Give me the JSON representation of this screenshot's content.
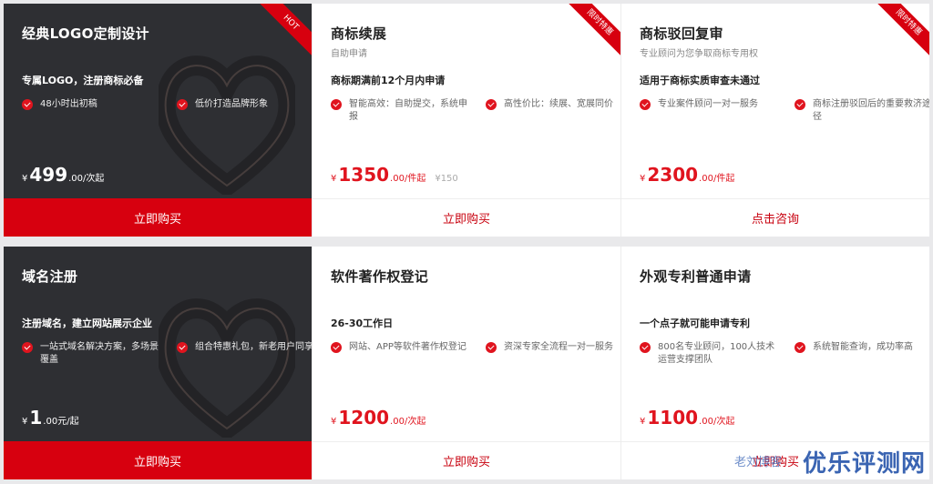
{
  "row1": {
    "card1": {
      "title": "经典LOGO定制设计",
      "headline": "专属LOGO，注册商标必备",
      "badge": "HOT",
      "features": [
        "48小时出初稿",
        "低价打造品牌形象"
      ],
      "currency": "¥",
      "amount": "499",
      "unit": ".00/次起",
      "button": "立即购买"
    },
    "card2": {
      "title": "商标续展",
      "subtitle": "自助申请",
      "headline": "商标期满前12个月内申请",
      "badge": "限时特惠",
      "features": [
        "智能高效：自助提交，系统申报",
        "高性价比：续展、宽展同价"
      ],
      "currency": "¥",
      "amount": "1350",
      "unit": ".00/件起",
      "original": "¥150",
      "button": "立即购买"
    },
    "card3": {
      "title": "商标驳回复审",
      "subtitle": "专业顾问为您争取商标专用权",
      "headline": "适用于商标实质审查未通过",
      "badge": "限时特惠",
      "features": [
        "专业案件顾问一对一服务",
        "商标注册驳回后的重要救济途径"
      ],
      "currency": "¥",
      "amount": "2300",
      "unit": ".00/件起",
      "button": "点击咨询"
    }
  },
  "row2": {
    "card1": {
      "title": "域名注册",
      "headline": "注册域名，建立网站展示企业",
      "features": [
        "一站式域名解决方案，多场景覆盖",
        "组合特惠礼包，新老用户同享"
      ],
      "currency": "¥",
      "amount": "1",
      "unit": ".00元/起",
      "button": "立即购买"
    },
    "card2": {
      "title": "软件著作权登记",
      "headline": "26-30工作日",
      "features": [
        "网站、APP等软件著作权登记",
        "资深专家全流程一对一服务"
      ],
      "currency": "¥",
      "amount": "1200",
      "unit": ".00/次起",
      "button": "立即购买"
    },
    "card3": {
      "title": "外观专利普通申请",
      "headline": "一个点子就可能申请专利",
      "features": [
        "800名专业顾问，100人技术运营支撑团队",
        "系统智能查询，成功率高"
      ],
      "currency": "¥",
      "amount": "1100",
      "unit": ".00/次起",
      "button": "立即购买"
    }
  },
  "watermark": {
    "main": "优乐评测网",
    "small": "老刘博客"
  },
  "colors": {
    "accent": "#d7000f",
    "dark_card": "#2e2f33",
    "watermark": "#1f4fa8"
  }
}
